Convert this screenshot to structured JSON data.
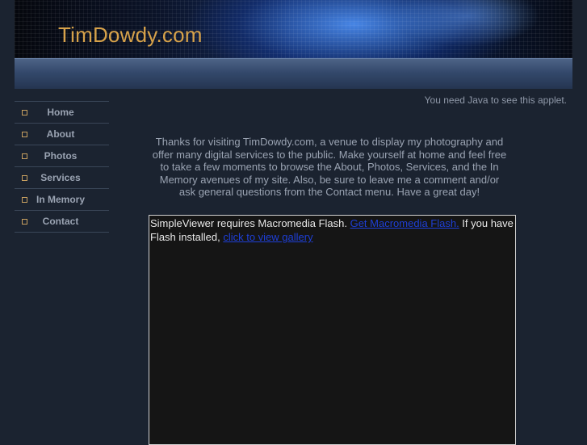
{
  "header": {
    "site_title": "TimDowdy.com"
  },
  "nav": {
    "items": [
      {
        "label": "Home"
      },
      {
        "label": "About"
      },
      {
        "label": "Photos"
      },
      {
        "label": "Services"
      },
      {
        "label": "In Memory"
      },
      {
        "label": "Contact"
      }
    ]
  },
  "main": {
    "applet_message": "You need Java to see this applet.",
    "intro_text": "Thanks for visiting TimDowdy.com, a venue to display my photography and offer many digital services to the public. Make yourself at home and feel free to take a few moments to browse the About, Photos, Services, and the In Memory avenues of my site. Also, be sure to leave me a comment and/or ask general questions from the Contact menu.  Have a great day!",
    "flash": {
      "text_before": "SimpleViewer requires Macromedia Flash. ",
      "get_flash_link": "Get Macromedia Flash.",
      "text_middle": " If you have Flash installed, ",
      "view_gallery_link": "click to view gallery"
    }
  },
  "colors": {
    "background": "#1b2330",
    "title_accent": "#d7a24a",
    "link": "#1e3fd6"
  }
}
